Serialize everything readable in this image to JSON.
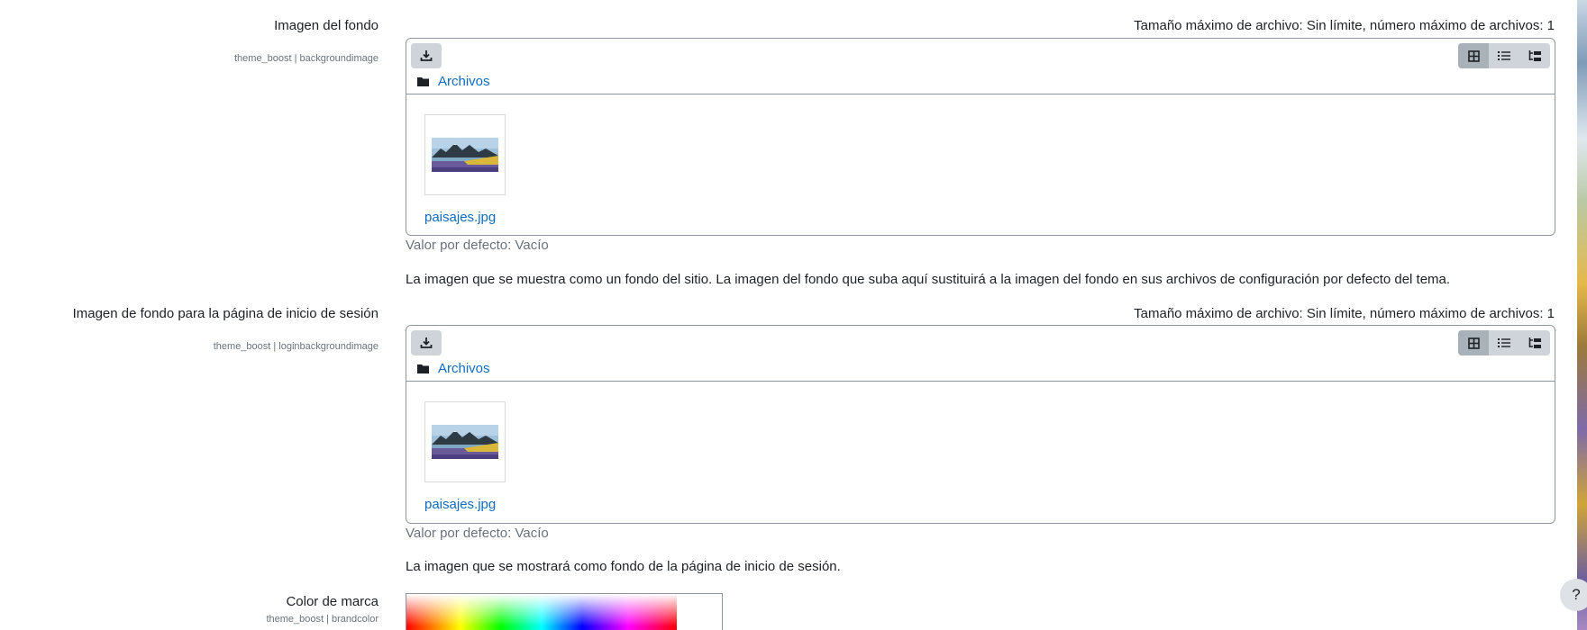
{
  "settings": [
    {
      "label": "Imagen del fondo",
      "sublabel": "theme_boost | backgroundimage",
      "limit": "Tamaño máximo de archivo: Sin límite, número máximo de archivos: 1",
      "folder": "Archivos",
      "file": "paisajes.jpg",
      "default": "Valor por defecto: Vacío",
      "description": "La imagen que se muestra como un fondo del sitio. La imagen del fondo que suba aquí sustituirá a la imagen del fondo en sus archivos de configuración por defecto del tema."
    },
    {
      "label": "Imagen de fondo para la página de inicio de sesión",
      "sublabel": "theme_boost | loginbackgroundimage",
      "limit": "Tamaño máximo de archivo: Sin límite, número máximo de archivos: 1",
      "folder": "Archivos",
      "file": "paisajes.jpg",
      "default": "Valor por defecto: Vacío",
      "description": "La imagen que se mostrará como fondo de la página de inicio de sesión."
    },
    {
      "label": "Color de marca",
      "sublabel": "theme_boost | brandcolor"
    }
  ],
  "icons": {
    "download": "download-icon",
    "grid_view": "grid-view-icon",
    "list_view": "list-view-icon",
    "tree_view": "tree-view-icon",
    "folder": "folder-icon",
    "help": "help-icon"
  },
  "help_label": "?",
  "colors": {
    "link": "#0f6cbf",
    "border": "#8f959e",
    "muted": "#6a737b"
  }
}
